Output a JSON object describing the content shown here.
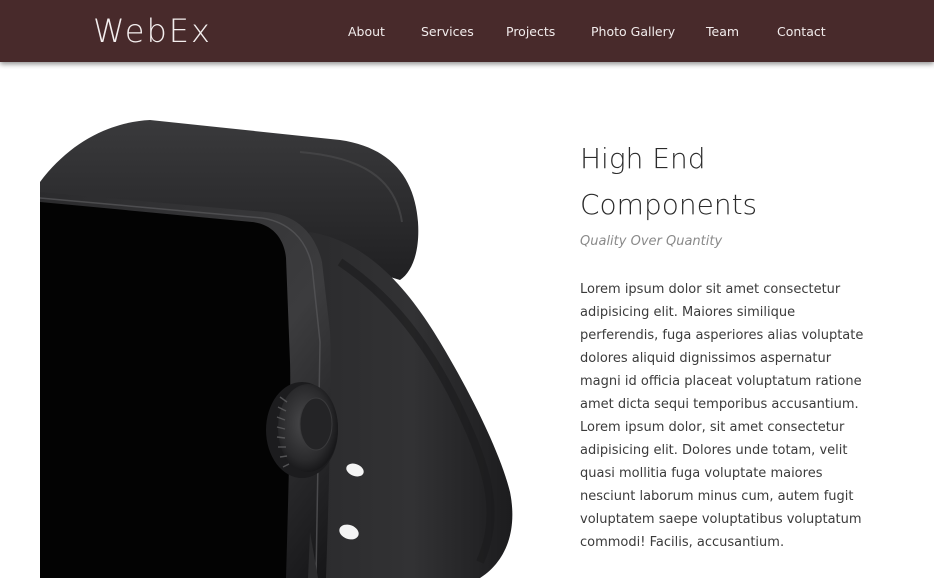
{
  "brand": {
    "name": "WebEx"
  },
  "nav": {
    "items": [
      {
        "label": "About"
      },
      {
        "label": "Services"
      },
      {
        "label": "Projects"
      },
      {
        "label": "Photo Gallery"
      },
      {
        "label": "Team"
      },
      {
        "label": "Contact"
      }
    ]
  },
  "feature": {
    "title_line1": "High End",
    "title_line2": "Components",
    "subtitle": "Quality Over Quantity",
    "body": "Lorem ipsum dolor sit amet consectetur adipisicing elit. Maiores similique perferendis, fuga asperiores alias voluptate dolores aliquid dignissimos aspernatur magni id officia placeat voluptatum ratione amet dicta sequi temporibus accusantium. Lorem ipsum dolor, sit amet consectetur adipisicing elit. Dolores unde totam, velit quasi mollitia fuga voluptate maiores nesciunt laborum minus cum, autem fugit voluptatem saepe voluptatibus voluptatum commodi! Facilis, accusantium."
  },
  "colors": {
    "navbar_background": "#482a2b",
    "nav_text": "#f2ecec",
    "page_background": "#ffffff",
    "heading_text": "#2b2b2b",
    "subtitle_text": "#8a8a8a",
    "body_text": "#3b3b3b"
  },
  "icons": {
    "hero": "smartwatch-image"
  }
}
